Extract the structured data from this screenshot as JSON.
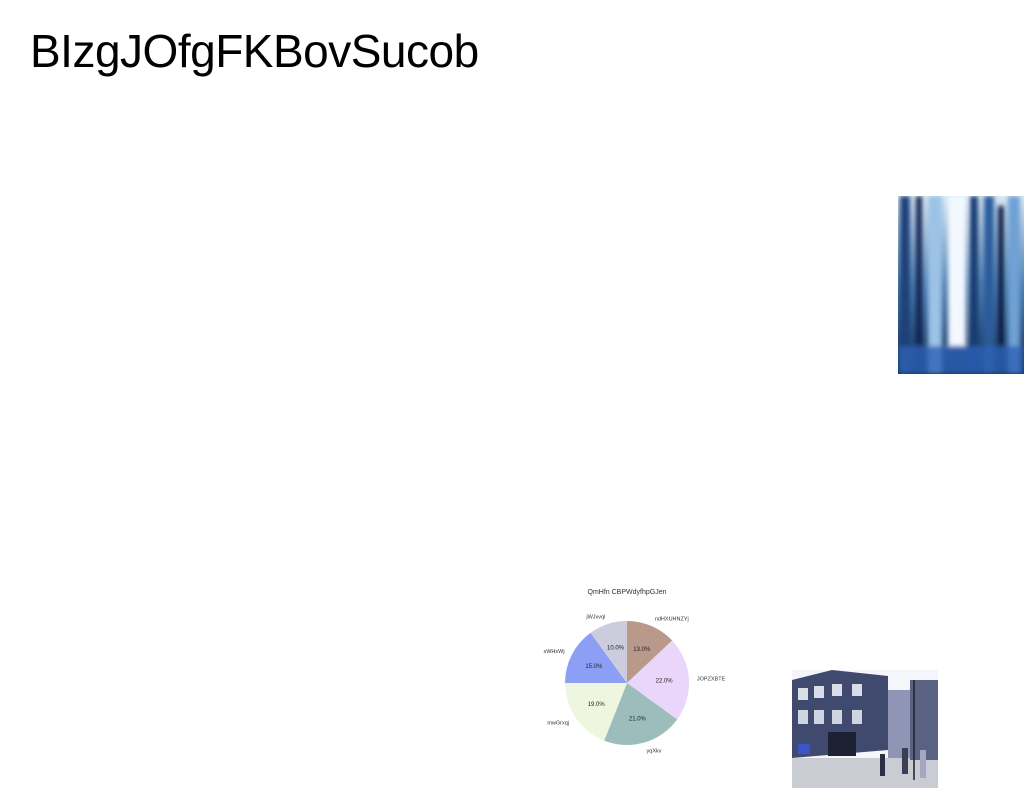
{
  "page": {
    "title": "BIzgJOfgFKBovSucob"
  },
  "images": {
    "forest": {
      "name": "forest-photo"
    },
    "street": {
      "name": "street-photo"
    }
  },
  "chart_data": {
    "type": "pie",
    "title": "QmHfn CBPWdyfhpGJen",
    "categories": [
      "ndHXUHNZYj",
      "JOPZXBTE",
      "yqXkv",
      "mwGrxqj",
      "sWHsWj",
      "jWJxvql"
    ],
    "values": [
      13.0,
      22.0,
      21.0,
      19.0,
      15.0,
      10.0
    ],
    "value_labels": [
      "13.0%",
      "22.0%",
      "21.0%",
      "19.0%",
      "15.0%",
      "10.0%"
    ],
    "colors": [
      "#b9998a",
      "#ead6fb",
      "#9dbdbc",
      "#eef6e0",
      "#8c9ff5",
      "#ccccdc"
    ],
    "legend": "none"
  }
}
